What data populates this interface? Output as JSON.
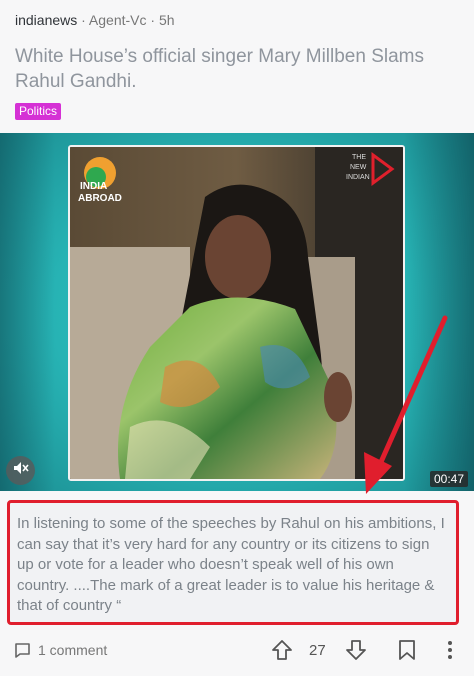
{
  "post": {
    "source": "indianews",
    "meta": " · Agent-Vc · 5h",
    "title": "White House’s official singer Mary Millben Slams Rahul Gandhi.",
    "tag": "Politics",
    "video": {
      "duration": "00:47",
      "logo_left": [
        "INDIA",
        "ABROAD"
      ],
      "logo_right": [
        "THE",
        "NEW",
        "INDIAN"
      ]
    },
    "quote": "In listening to some of the speeches by Rahul on his ambitions, I can say that it’s very hard for any country or its citizens to sign up or vote for a leader who doesn’t speak well of his own country. ....The mark of a great leader is to value his heritage & that of country “"
  },
  "footer": {
    "comments_label": "1 comment",
    "vote_count": "27"
  },
  "colors": {
    "tag_bg": "#d531d5",
    "annotation_red": "#e01e2d",
    "video_teal": "#2fc7c4"
  }
}
